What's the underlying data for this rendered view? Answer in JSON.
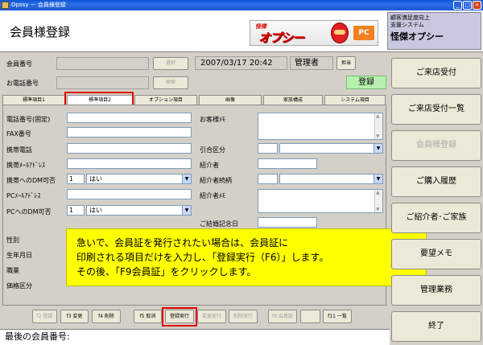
{
  "window": {
    "title": "Opssy － 会員様登録"
  },
  "header": {
    "page_title": "会員様登録",
    "logo": {
      "small": "怪傑",
      "big": "オプシー",
      "pc": "PC"
    },
    "company": {
      "line1": "顧客満足度向上",
      "line2": "支援システム",
      "name": "怪傑オプシー"
    }
  },
  "form": {
    "member_no_label": "会員番号",
    "phone_label": "お電話番号",
    "select_btn": "選択",
    "search_btn": "検索",
    "datetime": "2007/03/17 20:42",
    "staff": "管理者",
    "staff_btn": "担当",
    "mode": "登録"
  },
  "tabs": [
    "標準項目1",
    "標準項目2",
    "オプション項目",
    "画像",
    "家族構成",
    "システム項目"
  ],
  "left_fields": {
    "tel_fixed": "電話番号(固定)",
    "fax": "FAX番号",
    "mobile": "携帯電話",
    "mobile_mail": "携帯ﾒｰﾙｱﾄﾞﾚｽ",
    "mobile_dm": "携帯へのDM可否",
    "pc_mail": "PCﾒｰﾙｱﾄﾞﾚｽ",
    "pc_dm": "PCへのDM可否",
    "gender": "性別",
    "birthday": "生年月日",
    "job": "職業",
    "price": "価格区分",
    "dm_num": "1",
    "dm_val": "はい"
  },
  "right_fields": {
    "customer_memo": "お客様ﾒﾓ",
    "pull_type": "引合区分",
    "referrer": "紹介者",
    "referrer_rel": "紹介者続柄",
    "referrer_memo": "紹介者ﾒﾓ",
    "anniversary": "ご結婚記念日"
  },
  "callout": {
    "line1": "急いで、会員証を発行されたい場合は、会員証に",
    "line2": "印刷される項目だけを入力し、「登録実行（F6）」します。",
    "line3": "その後、「F9会員証」をクリックします。"
  },
  "fkeys": [
    "f2 登録",
    "f3 変更",
    "f4 削除",
    "f5 取消",
    "登録実行",
    "変更実行",
    "削除実行",
    "f9 会員証",
    "",
    "f11 一覧"
  ],
  "side_buttons": [
    "ご来店受付",
    "ご来店受付一覧",
    "会員様登録",
    "ご購入履歴",
    "ご紹介者･ご家族",
    "要望メモ",
    "管理業務",
    "終了"
  ],
  "bottom": {
    "last_member": "最後の会員番号:"
  }
}
